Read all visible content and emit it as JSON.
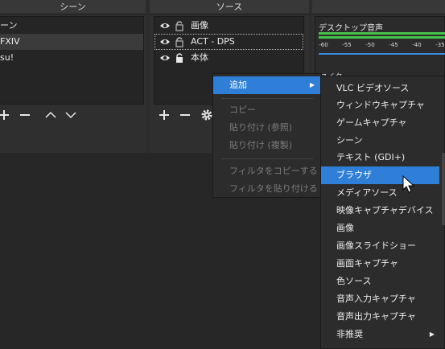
{
  "docks": {
    "scenes": {
      "title": "シーン",
      "items": [
        "ーン",
        "FXIV",
        "su!"
      ]
    },
    "sources": {
      "title": "ソース",
      "items": [
        "画像",
        "ACT - DPS",
        "本体"
      ]
    }
  },
  "mixer": {
    "track_label": "デスクトップ音声",
    "partial_label": "マイク",
    "ticks": [
      "-60",
      "-55",
      "-50",
      "-45",
      "-40",
      "-35"
    ]
  },
  "context_menu": {
    "add": "追加",
    "copy": "コピー",
    "paste_ref": "貼り付け (参照)",
    "paste_dup": "貼り付け (複製)",
    "copy_filters": "フィルタをコピーする",
    "paste_filters": "フィルタを貼り付ける"
  },
  "submenu": {
    "items": [
      "VLC ビデオソース",
      "ウィンドウキャプチャ",
      "ゲームキャプチャ",
      "シーン",
      "テキスト (GDI+)",
      "ブラウザ",
      "メディアソース",
      "映像キャプチャデバイス",
      "画像",
      "画像スライドショー",
      "画面キャプチャ",
      "色ソース",
      "音声入力キャプチャ",
      "音声出力キャプチャ",
      "非推奨"
    ],
    "highlighted": "ブラウザ"
  },
  "colors": {
    "highlight": "#2f7fd8",
    "meter_green": "#45c24a",
    "meter_blue": "#3b8be0"
  },
  "icons": [
    "eye-icon",
    "lock-icon",
    "plus-icon",
    "minus-icon",
    "up-icon",
    "down-icon",
    "gear-icon",
    "submenu-arrow-icon",
    "mouse-cursor-icon"
  ]
}
